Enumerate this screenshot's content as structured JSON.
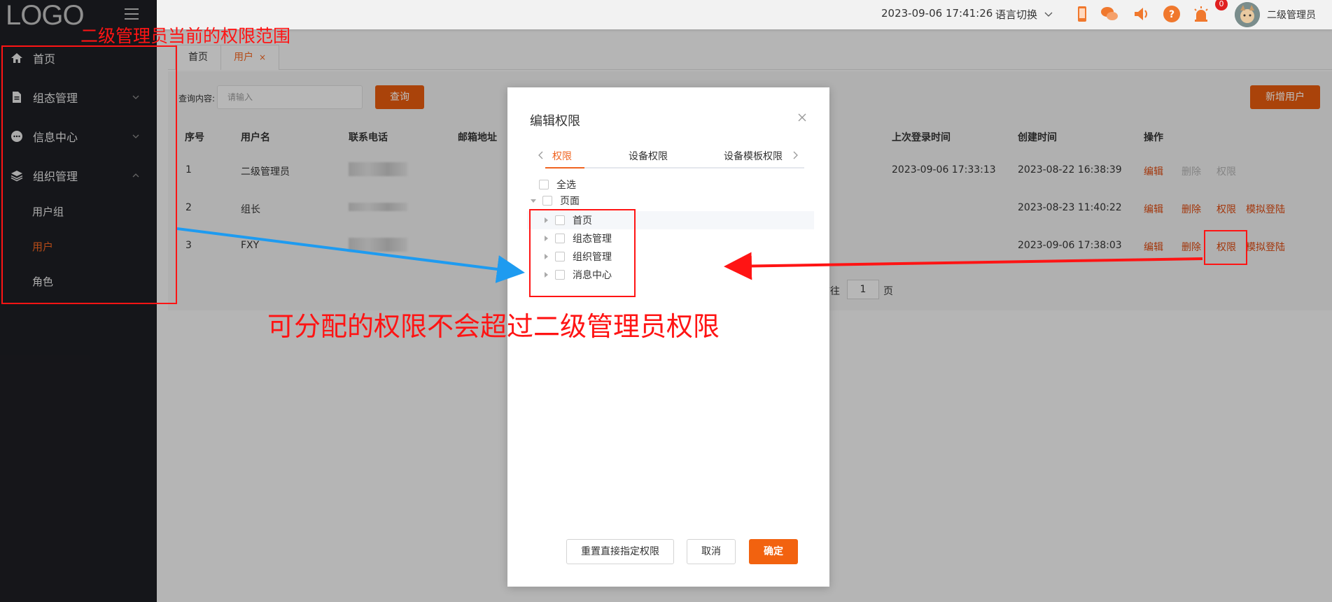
{
  "sidebar": {
    "logo": "LOGO",
    "items": [
      {
        "label": "首页",
        "icon": "home-icon"
      },
      {
        "label": "组态管理",
        "icon": "document-icon"
      },
      {
        "label": "信息中心",
        "icon": "chat-icon"
      },
      {
        "label": "组织管理",
        "icon": "layers-icon"
      }
    ],
    "sub_items": [
      {
        "label": "用户组"
      },
      {
        "label": "用户",
        "active": true
      },
      {
        "label": "角色"
      }
    ]
  },
  "header": {
    "datetime": "2023-09-06 17:41:26",
    "language": "语言切换",
    "badge_count": "0",
    "user": "二级管理员",
    "icons": [
      "phone-icon",
      "wechat-icon",
      "speaker-icon",
      "help-icon",
      "alarm-icon"
    ]
  },
  "tabs": [
    {
      "label": "首页"
    },
    {
      "label": "用户",
      "active": true,
      "close": "×"
    }
  ],
  "search": {
    "label": "查询内容:",
    "placeholder": "请输入",
    "button": "查询",
    "add_button": "新增用户"
  },
  "table": {
    "columns": [
      "序号",
      "用户名",
      "联系电话",
      "邮箱地址",
      "上次登录时间",
      "创建时间",
      "操作"
    ],
    "rows": [
      {
        "no": "1",
        "name": "二级管理员",
        "last_login": "2023-09-06 17:33:13",
        "created": "2023-08-22 16:38:39",
        "ops": [
          "编辑",
          "删除",
          "权限"
        ],
        "disabled": true
      },
      {
        "no": "2",
        "name": "组长",
        "last_login": "",
        "created": "2023-08-23 11:40:22",
        "ops": [
          "编辑",
          "删除",
          "权限",
          "模拟登陆"
        ],
        "disabled": false
      },
      {
        "no": "3",
        "name": "FXY",
        "last_login": "",
        "created": "2023-09-06 17:38:03",
        "ops": [
          "编辑",
          "删除",
          "权限",
          "模拟登陆"
        ],
        "disabled": false
      }
    ]
  },
  "pager": {
    "goto": "前往",
    "page": "1",
    "unit": "页"
  },
  "modal": {
    "title": "编辑权限",
    "tabs": [
      "权限",
      "设备权限",
      "设备模板权限"
    ],
    "select_all": "全选",
    "root": "页面",
    "children": [
      "首页",
      "组态管理",
      "组织管理",
      "消息中心"
    ],
    "buttons": {
      "reset": "重置直接指定权限",
      "cancel": "取消",
      "ok": "确定"
    }
  },
  "annotations": {
    "sidebar_note": "二级管理员当前的权限范围",
    "main_note": "可分配的权限不会超过二级管理员权限",
    "color": "#ff1414"
  },
  "colors": {
    "accent": "#f06421",
    "sidebar_bg": "#1d1e23"
  }
}
